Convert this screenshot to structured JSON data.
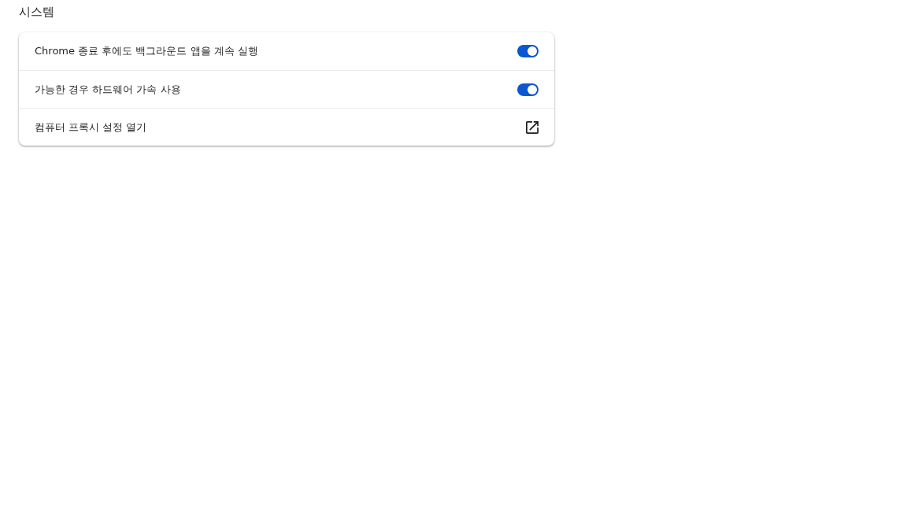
{
  "section": {
    "title": "시스템"
  },
  "rows": [
    {
      "kind": "toggle",
      "label": "Chrome 종료 후에도 백그라운드 앱을 계속 실행",
      "on": true
    },
    {
      "kind": "toggle",
      "label": "가능한 경우 하드웨어 가속 사용",
      "on": true
    },
    {
      "kind": "link",
      "label": "컴퓨터 프록시 설정 열기"
    }
  ]
}
